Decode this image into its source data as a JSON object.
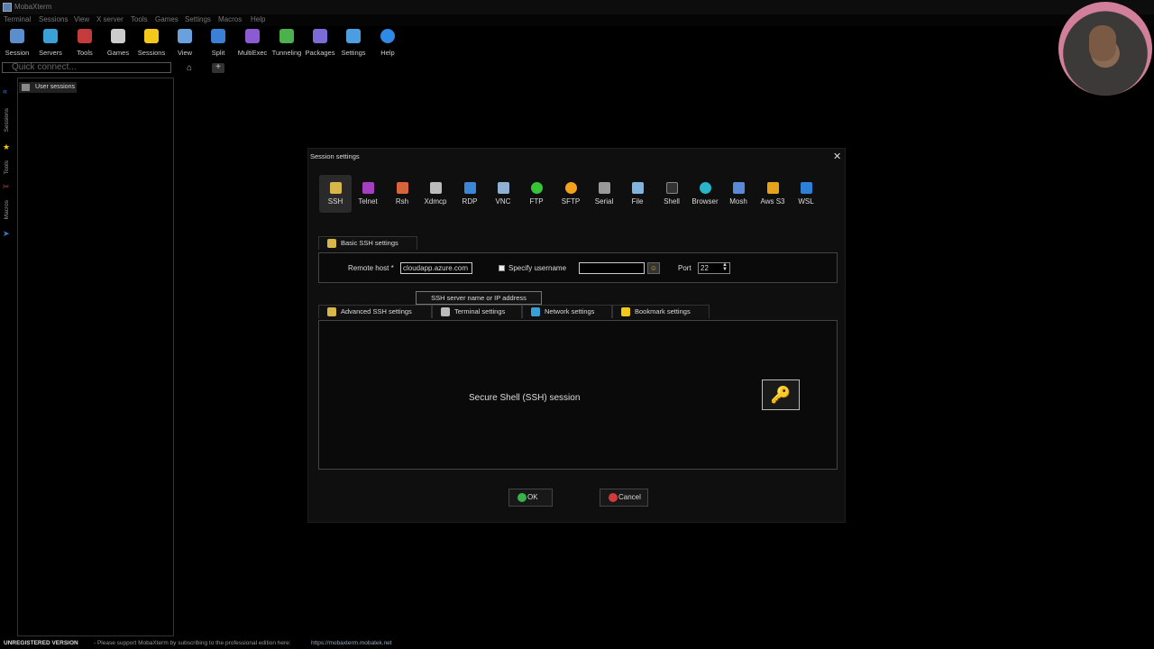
{
  "app": {
    "title": "MobaXterm"
  },
  "menu": [
    "Terminal",
    "Sessions",
    "View",
    "X server",
    "Tools",
    "Games",
    "Settings",
    "Macros",
    "Help"
  ],
  "toolbar": [
    {
      "label": "Session",
      "icon": "session-icon",
      "color": "#5b8ecf"
    },
    {
      "label": "Servers",
      "icon": "servers-icon",
      "color": "#3aa0d8"
    },
    {
      "label": "Tools",
      "icon": "tools-icon",
      "color": "#c43b3b"
    },
    {
      "label": "Games",
      "icon": "games-icon",
      "color": "#cccccc"
    },
    {
      "label": "Sessions",
      "icon": "star-icon",
      "color": "#f2c81b"
    },
    {
      "label": "View",
      "icon": "view-icon",
      "color": "#6aa0dd"
    },
    {
      "label": "Split",
      "icon": "split-icon",
      "color": "#3b7fd6"
    },
    {
      "label": "MultiExec",
      "icon": "multiexec-icon",
      "color": "#8a5bd1"
    },
    {
      "label": "Tunneling",
      "icon": "tunneling-icon",
      "color": "#4cb04c"
    },
    {
      "label": "Packages",
      "icon": "packages-icon",
      "color": "#7b6bd6"
    },
    {
      "label": "Settings",
      "icon": "settings-icon",
      "color": "#4c9ee0"
    },
    {
      "label": "Help",
      "icon": "help-icon",
      "color": "#2e8ae6"
    }
  ],
  "quick_connect": {
    "placeholder": "Quick connect..."
  },
  "left_strip": {
    "sessions": "Sessions",
    "tools": "Tools",
    "macros": "Macros"
  },
  "sidebar": {
    "user_sessions": "User sessions"
  },
  "status": {
    "unregistered": "UNREGISTERED VERSION",
    "message": "-  Please support MobaXterm by subscribing to the professional edition here:",
    "link": "https://mobaxterm.mobatek.net"
  },
  "dialog": {
    "title": "Session settings",
    "protocols": [
      {
        "label": "SSH",
        "color": "#d8b64a"
      },
      {
        "label": "Telnet",
        "color": "#a53fbf"
      },
      {
        "label": "Rsh",
        "color": "#d8643a"
      },
      {
        "label": "Xdmcp",
        "color": "#bbbbbb"
      },
      {
        "label": "RDP",
        "color": "#3c86d8"
      },
      {
        "label": "VNC",
        "color": "#8fb0d0"
      },
      {
        "label": "FTP",
        "color": "#37c437"
      },
      {
        "label": "SFTP",
        "color": "#f2a31b"
      },
      {
        "label": "Serial",
        "color": "#999999"
      },
      {
        "label": "File",
        "color": "#7fb3e0"
      },
      {
        "label": "Shell",
        "color": "#333333"
      },
      {
        "label": "Browser",
        "color": "#29b6c9"
      },
      {
        "label": "Mosh",
        "color": "#5a8ad6"
      },
      {
        "label": "Aws S3",
        "color": "#e6a21a"
      },
      {
        "label": "WSL",
        "color": "#2e7fd6"
      }
    ],
    "basic_tab": "Basic SSH settings",
    "remote_host_label": "Remote host *",
    "remote_host_value": "cloudapp.azure.com",
    "specify_username_label": "Specify username",
    "username_value": "",
    "port_label": "Port",
    "port_value": "22",
    "tooltip": "SSH server name or IP address",
    "tabs": [
      {
        "label": "Advanced SSH settings",
        "color": "#d8b64a"
      },
      {
        "label": "Terminal settings",
        "color": "#bbbbbb"
      },
      {
        "label": "Network settings",
        "color": "#3aa0d8"
      },
      {
        "label": "Bookmark settings",
        "color": "#f2c81b"
      }
    ],
    "description": "Secure Shell (SSH) session",
    "ok": "OK",
    "cancel": "Cancel"
  }
}
